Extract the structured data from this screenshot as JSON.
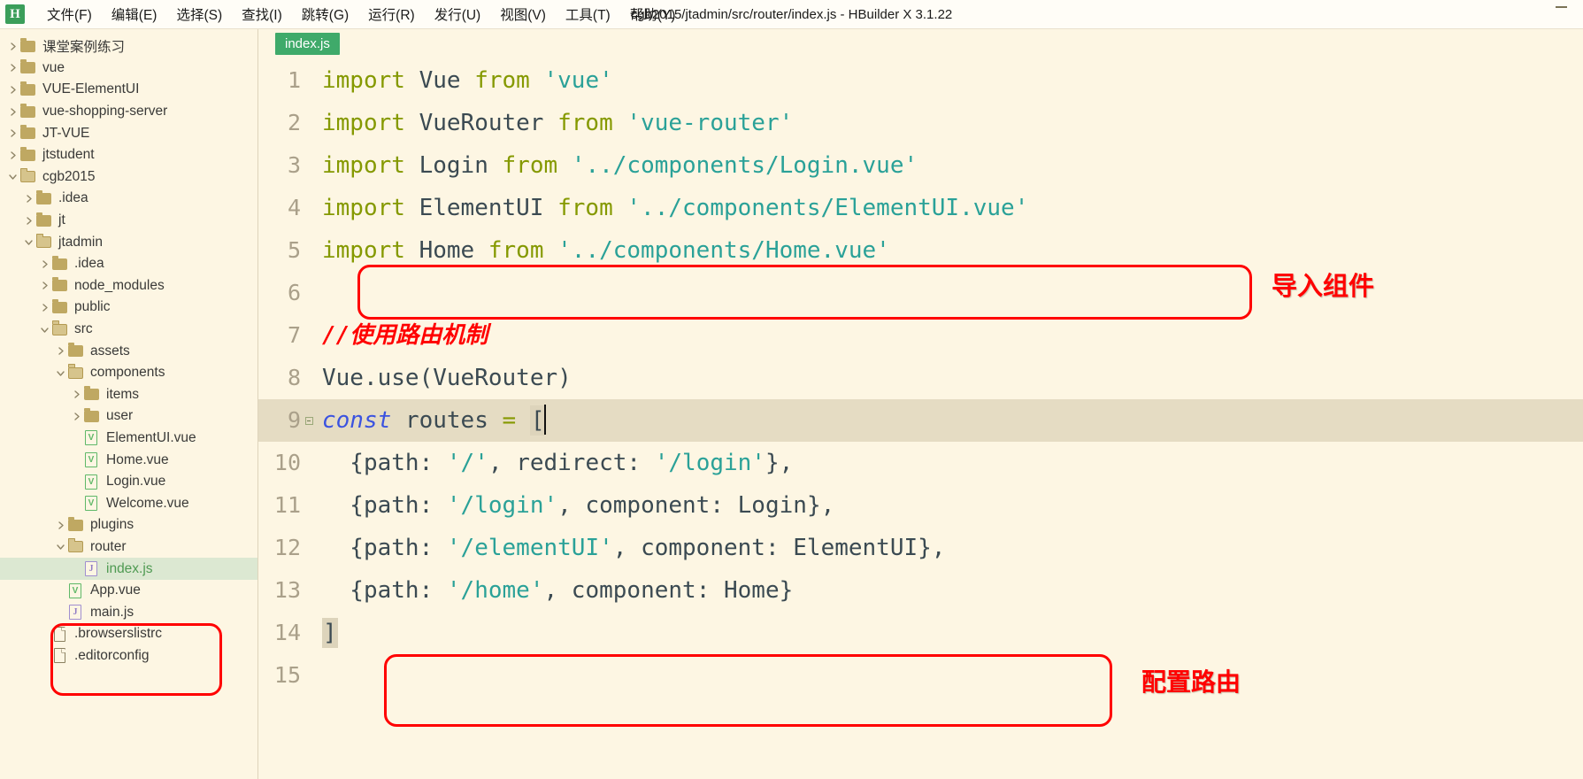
{
  "window": {
    "title": "cgb2015/jtadmin/src/router/index.js - HBuilder X 3.1.22",
    "logo_letter": "H",
    "minimize_label": "minimize"
  },
  "menubar": {
    "items": [
      {
        "label": "文件(F)",
        "name": "menu-file"
      },
      {
        "label": "编辑(E)",
        "name": "menu-edit"
      },
      {
        "label": "选择(S)",
        "name": "menu-select"
      },
      {
        "label": "查找(I)",
        "name": "menu-find"
      },
      {
        "label": "跳转(G)",
        "name": "menu-goto"
      },
      {
        "label": "运行(R)",
        "name": "menu-run"
      },
      {
        "label": "发行(U)",
        "name": "menu-publish"
      },
      {
        "label": "视图(V)",
        "name": "menu-view"
      },
      {
        "label": "工具(T)",
        "name": "menu-tools"
      },
      {
        "label": "帮助(Y)",
        "name": "menu-help"
      }
    ]
  },
  "sidebar": {
    "tree": [
      {
        "label": "课堂案例练习",
        "depth": 0,
        "type": "folder",
        "state": "collapsed",
        "selected": false
      },
      {
        "label": "vue",
        "depth": 0,
        "type": "folder",
        "state": "collapsed",
        "selected": false
      },
      {
        "label": "VUE-ElementUI",
        "depth": 0,
        "type": "folder",
        "state": "collapsed",
        "selected": false
      },
      {
        "label": "vue-shopping-server",
        "depth": 0,
        "type": "folder",
        "state": "collapsed",
        "selected": false
      },
      {
        "label": "JT-VUE",
        "depth": 0,
        "type": "folder",
        "state": "collapsed",
        "selected": false
      },
      {
        "label": "jtstudent",
        "depth": 0,
        "type": "folder",
        "state": "collapsed",
        "selected": false
      },
      {
        "label": "cgb2015",
        "depth": 0,
        "type": "folder",
        "state": "expanded",
        "selected": false
      },
      {
        "label": ".idea",
        "depth": 1,
        "type": "folder",
        "state": "collapsed",
        "selected": false
      },
      {
        "label": "jt",
        "depth": 1,
        "type": "folder",
        "state": "collapsed",
        "selected": false
      },
      {
        "label": "jtadmin",
        "depth": 1,
        "type": "folder",
        "state": "expanded",
        "selected": false
      },
      {
        "label": ".idea",
        "depth": 2,
        "type": "folder",
        "state": "collapsed",
        "selected": false
      },
      {
        "label": "node_modules",
        "depth": 2,
        "type": "folder",
        "state": "collapsed",
        "selected": false
      },
      {
        "label": "public",
        "depth": 2,
        "type": "folder",
        "state": "collapsed",
        "selected": false
      },
      {
        "label": "src",
        "depth": 2,
        "type": "folder",
        "state": "expanded",
        "selected": false
      },
      {
        "label": "assets",
        "depth": 3,
        "type": "folder",
        "state": "collapsed",
        "selected": false
      },
      {
        "label": "components",
        "depth": 3,
        "type": "folder",
        "state": "expanded",
        "selected": false
      },
      {
        "label": "items",
        "depth": 4,
        "type": "folder",
        "state": "collapsed",
        "selected": false
      },
      {
        "label": "user",
        "depth": 4,
        "type": "folder",
        "state": "collapsed",
        "selected": false
      },
      {
        "label": "ElementUI.vue",
        "depth": 4,
        "type": "vue",
        "state": "leaf",
        "selected": false
      },
      {
        "label": "Home.vue",
        "depth": 4,
        "type": "vue",
        "state": "leaf",
        "selected": false
      },
      {
        "label": "Login.vue",
        "depth": 4,
        "type": "vue",
        "state": "leaf",
        "selected": false
      },
      {
        "label": "Welcome.vue",
        "depth": 4,
        "type": "vue",
        "state": "leaf",
        "selected": false
      },
      {
        "label": "plugins",
        "depth": 3,
        "type": "folder",
        "state": "collapsed",
        "selected": false
      },
      {
        "label": "router",
        "depth": 3,
        "type": "folder",
        "state": "expanded",
        "selected": false
      },
      {
        "label": "index.js",
        "depth": 4,
        "type": "js",
        "state": "leaf",
        "selected": true
      },
      {
        "label": "App.vue",
        "depth": 3,
        "type": "vue",
        "state": "leaf",
        "selected": false
      },
      {
        "label": "main.js",
        "depth": 3,
        "type": "js",
        "state": "leaf",
        "selected": false
      },
      {
        "label": ".browserslistrc",
        "depth": 2,
        "type": "file",
        "state": "leaf",
        "selected": false
      },
      {
        "label": ".editorconfig",
        "depth": 2,
        "type": "file",
        "state": "leaf",
        "selected": false
      }
    ]
  },
  "editor": {
    "tab": {
      "label": "index.js"
    },
    "lines": [
      {
        "n": "1",
        "fold": false,
        "current": false,
        "tokens": [
          {
            "t": "import",
            "c": "kw"
          },
          {
            "t": " ",
            "c": "punct"
          },
          {
            "t": "Vue",
            "c": "ident"
          },
          {
            "t": " ",
            "c": "punct"
          },
          {
            "t": "from",
            "c": "kw"
          },
          {
            "t": " ",
            "c": "punct"
          },
          {
            "t": "'vue'",
            "c": "str"
          }
        ]
      },
      {
        "n": "2",
        "fold": false,
        "current": false,
        "tokens": [
          {
            "t": "import",
            "c": "kw"
          },
          {
            "t": " ",
            "c": "punct"
          },
          {
            "t": "VueRouter",
            "c": "ident"
          },
          {
            "t": " ",
            "c": "punct"
          },
          {
            "t": "from",
            "c": "kw"
          },
          {
            "t": " ",
            "c": "punct"
          },
          {
            "t": "'vue-router'",
            "c": "str"
          }
        ]
      },
      {
        "n": "3",
        "fold": false,
        "current": false,
        "tokens": [
          {
            "t": "import",
            "c": "kw"
          },
          {
            "t": " ",
            "c": "punct"
          },
          {
            "t": "Login",
            "c": "ident"
          },
          {
            "t": " ",
            "c": "punct"
          },
          {
            "t": "from",
            "c": "kw"
          },
          {
            "t": " ",
            "c": "punct"
          },
          {
            "t": "'../components/Login.vue'",
            "c": "str"
          }
        ]
      },
      {
        "n": "4",
        "fold": false,
        "current": false,
        "tokens": [
          {
            "t": "import",
            "c": "kw"
          },
          {
            "t": " ",
            "c": "punct"
          },
          {
            "t": "ElementUI",
            "c": "ident"
          },
          {
            "t": " ",
            "c": "punct"
          },
          {
            "t": "from",
            "c": "kw"
          },
          {
            "t": " ",
            "c": "punct"
          },
          {
            "t": "'../components/ElementUI.vue'",
            "c": "str"
          }
        ]
      },
      {
        "n": "5",
        "fold": false,
        "current": false,
        "tokens": [
          {
            "t": "import",
            "c": "kw"
          },
          {
            "t": " ",
            "c": "punct"
          },
          {
            "t": "Home",
            "c": "ident"
          },
          {
            "t": " ",
            "c": "punct"
          },
          {
            "t": "from",
            "c": "kw"
          },
          {
            "t": " ",
            "c": "punct"
          },
          {
            "t": "'../components/Home.vue'",
            "c": "str"
          }
        ]
      },
      {
        "n": "6",
        "fold": false,
        "current": false,
        "tokens": []
      },
      {
        "n": "7",
        "fold": false,
        "current": false,
        "tokens": [
          {
            "t": "//使用路由机制",
            "c": "comment-red"
          }
        ]
      },
      {
        "n": "8",
        "fold": false,
        "current": false,
        "tokens": [
          {
            "t": "Vue",
            "c": "ident"
          },
          {
            "t": ".",
            "c": "punct"
          },
          {
            "t": "use",
            "c": "ident"
          },
          {
            "t": "(",
            "c": "punct"
          },
          {
            "t": "VueRouter",
            "c": "ident"
          },
          {
            "t": ")",
            "c": "punct"
          }
        ]
      },
      {
        "n": "9",
        "fold": true,
        "current": true,
        "tokens": [
          {
            "t": "const",
            "c": "const-kw"
          },
          {
            "t": " ",
            "c": "punct"
          },
          {
            "t": "routes",
            "c": "ident"
          },
          {
            "t": " ",
            "c": "punct"
          },
          {
            "t": "=",
            "c": "op"
          },
          {
            "t": " ",
            "c": "punct"
          },
          {
            "t": "[",
            "c": "brkhl"
          }
        ]
      },
      {
        "n": "10",
        "fold": false,
        "current": false,
        "tokens": [
          {
            "t": "  {",
            "c": "punct"
          },
          {
            "t": "path",
            "c": "ident"
          },
          {
            "t": ": ",
            "c": "punct"
          },
          {
            "t": "'/'",
            "c": "str"
          },
          {
            "t": ", ",
            "c": "punct"
          },
          {
            "t": "redirect",
            "c": "ident"
          },
          {
            "t": ": ",
            "c": "punct"
          },
          {
            "t": "'/login'",
            "c": "str"
          },
          {
            "t": "},",
            "c": "punct"
          }
        ]
      },
      {
        "n": "11",
        "fold": false,
        "current": false,
        "tokens": [
          {
            "t": "  {",
            "c": "punct"
          },
          {
            "t": "path",
            "c": "ident"
          },
          {
            "t": ": ",
            "c": "punct"
          },
          {
            "t": "'/login'",
            "c": "str"
          },
          {
            "t": ", ",
            "c": "punct"
          },
          {
            "t": "component",
            "c": "ident"
          },
          {
            "t": ": ",
            "c": "punct"
          },
          {
            "t": "Login",
            "c": "ident"
          },
          {
            "t": "},",
            "c": "punct"
          }
        ]
      },
      {
        "n": "12",
        "fold": false,
        "current": false,
        "tokens": [
          {
            "t": "  {",
            "c": "punct"
          },
          {
            "t": "path",
            "c": "ident"
          },
          {
            "t": ": ",
            "c": "punct"
          },
          {
            "t": "'/elementUI'",
            "c": "str"
          },
          {
            "t": ", ",
            "c": "punct"
          },
          {
            "t": "component",
            "c": "ident"
          },
          {
            "t": ": ",
            "c": "punct"
          },
          {
            "t": "ElementUI",
            "c": "ident"
          },
          {
            "t": "},",
            "c": "punct"
          }
        ]
      },
      {
        "n": "13",
        "fold": false,
        "current": false,
        "tokens": [
          {
            "t": "  {",
            "c": "punct"
          },
          {
            "t": "path",
            "c": "ident"
          },
          {
            "t": ": ",
            "c": "punct"
          },
          {
            "t": "'/home'",
            "c": "str"
          },
          {
            "t": ", ",
            "c": "punct"
          },
          {
            "t": "component",
            "c": "ident"
          },
          {
            "t": ": ",
            "c": "punct"
          },
          {
            "t": "Home",
            "c": "ident"
          },
          {
            "t": "}",
            "c": "punct"
          }
        ]
      },
      {
        "n": "14",
        "fold": false,
        "current": false,
        "tokens": [
          {
            "t": "]",
            "c": "brkhl"
          }
        ]
      },
      {
        "n": "15",
        "fold": false,
        "current": false,
        "tokens": []
      }
    ]
  },
  "annotations": [
    {
      "name": "annot-label-import-components",
      "text": "导入组件"
    },
    {
      "name": "annot-label-configure-routes",
      "text": "配置路由"
    }
  ]
}
